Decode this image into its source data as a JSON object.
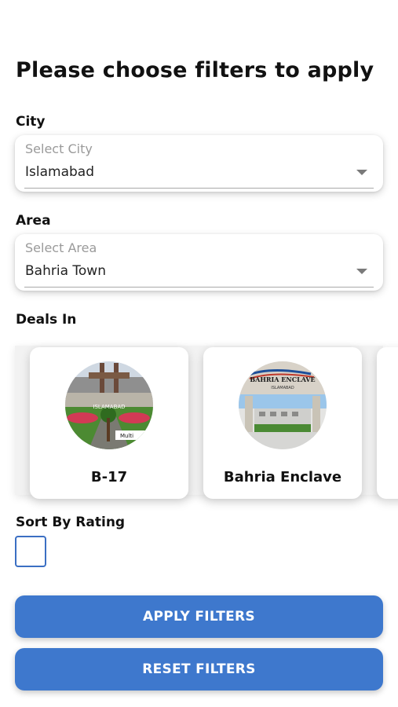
{
  "header": {
    "title": "Please choose filters to apply"
  },
  "city": {
    "label": "City",
    "placeholder": "Select City",
    "value": "Islamabad"
  },
  "area": {
    "label": "Area",
    "placeholder": "Select Area",
    "value": "Bahria Town"
  },
  "deals": {
    "label": "Deals In",
    "items": [
      {
        "name": "B-17",
        "image_sign_text": "ISLAMABAD",
        "image_tag": "Multi"
      },
      {
        "name": "Bahria Enclave",
        "image_sign_text": "BAHRIA ENCLAVE",
        "image_sign_sub": "ISLAMABAD"
      }
    ]
  },
  "sort": {
    "label": "Sort By Rating",
    "checked": false
  },
  "actions": {
    "apply_label": "APPLY FILTERS",
    "reset_label": "RESET FILTERS"
  },
  "colors": {
    "accent": "#3e78cd",
    "checkbox_border": "#3b6fc3"
  },
  "icons": {
    "select_caret": "caret-down-icon"
  }
}
